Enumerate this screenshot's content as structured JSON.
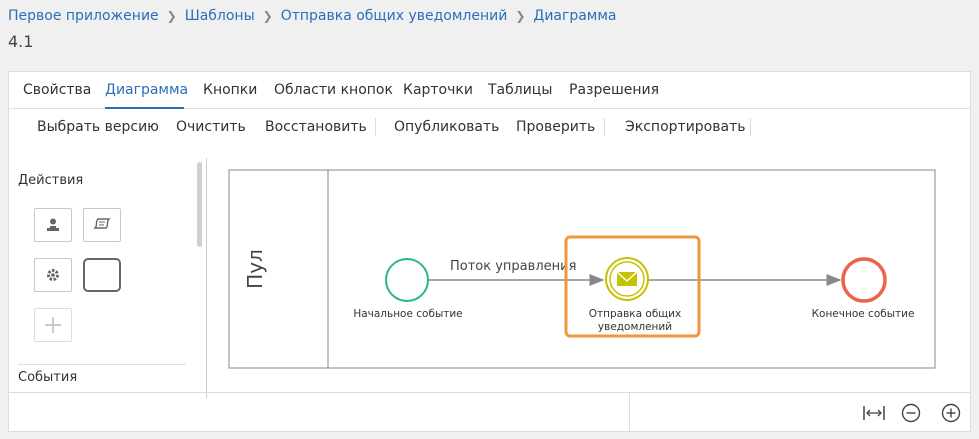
{
  "breadcrumb": [
    "Первое приложение",
    "Шаблоны",
    "Отправка общих уведомлений",
    "Диаграмма"
  ],
  "page": {
    "title": "4.1"
  },
  "tabs": [
    "Свойства",
    "Диаграмма",
    "Кнопки",
    "Области кнопок",
    "Карточки",
    "Таблицы",
    "Разрешения"
  ],
  "active_tab": "Диаграмма",
  "toolbar": [
    "Выбрать версию",
    "Очистить",
    "Восстановить",
    "Опубликовать",
    "Проверить",
    "Экспортировать"
  ],
  "palette": {
    "sections": [
      "Действия",
      "События"
    ],
    "icons": [
      "user-task-icon",
      "script-task-icon",
      "service-task-icon",
      "empty-task-icon",
      "add-icon"
    ]
  },
  "diagram": {
    "pool_label": "Пул",
    "flow_label": "Поток управления",
    "start_event": "Начальное событие",
    "send_task_line1": "Отправка общих",
    "send_task_line2": "уведомлений",
    "end_event": "Конечное событие"
  },
  "colors": {
    "link": "#2a6ebb",
    "start": "#2bb58a",
    "end": "#e8664a",
    "message": "#c5c200",
    "highlight": "#f0963c"
  },
  "zoom_icons": [
    "fit-width-icon",
    "zoom-out-icon",
    "zoom-in-icon"
  ]
}
